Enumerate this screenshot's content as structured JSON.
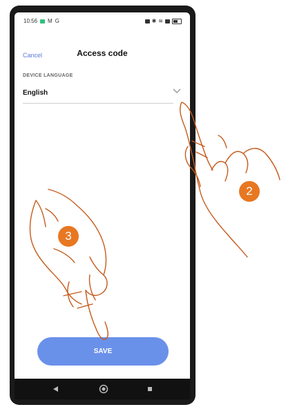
{
  "status_bar": {
    "time": "10:56",
    "app_icons": [
      "M",
      "G"
    ]
  },
  "header": {
    "cancel_label": "Cancel",
    "title": "Access code"
  },
  "device_language": {
    "label": "DEVICE LANGUAGE",
    "value": "English"
  },
  "save_label": "SAVE",
  "steps": {
    "step_2": "2",
    "step_3": "3"
  },
  "colors": {
    "accent": "#6a91ea",
    "link": "#5b7bd5",
    "step_badge": "#e87722",
    "hand_outline": "#c45a1c"
  }
}
